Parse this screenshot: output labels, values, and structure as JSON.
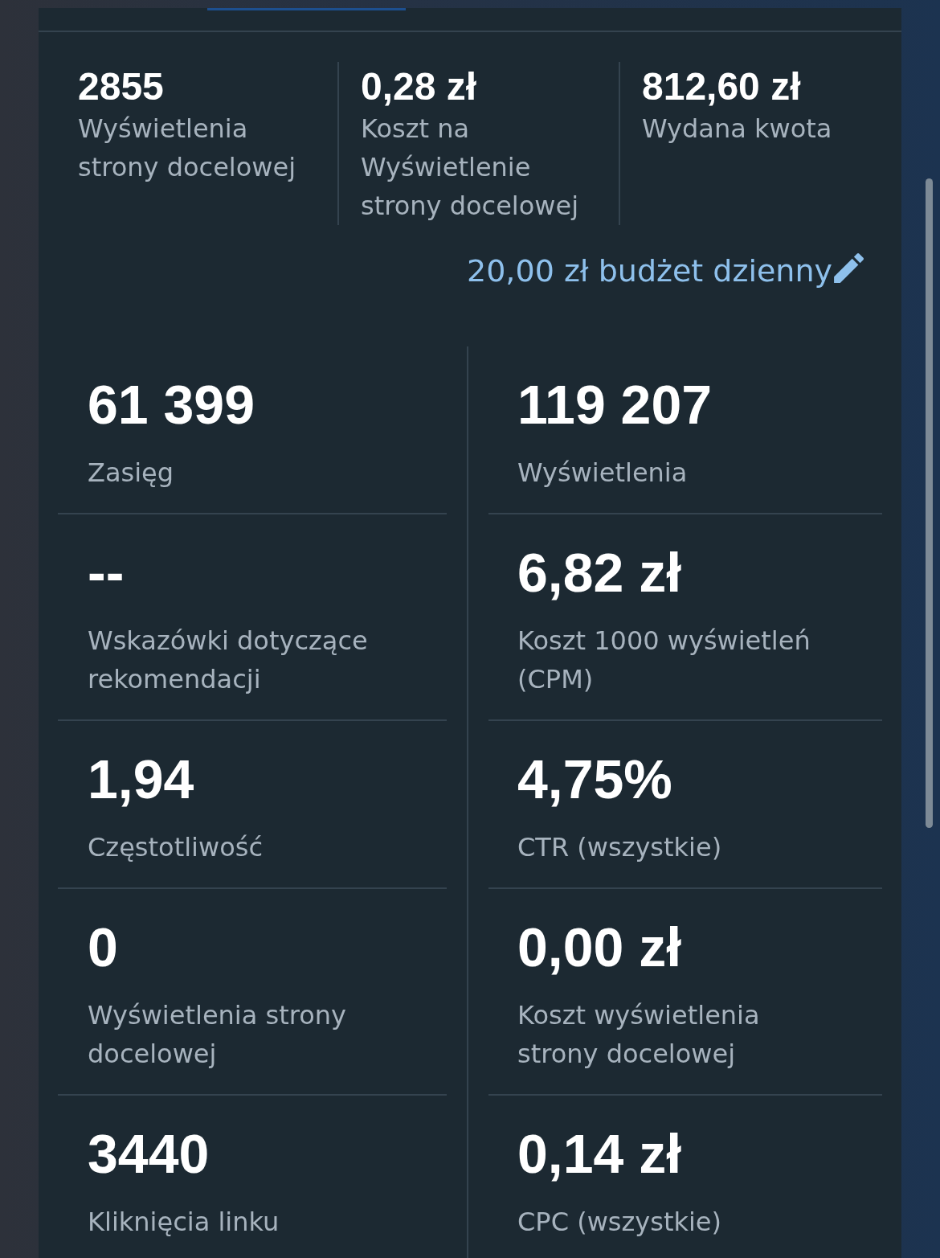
{
  "summary": [
    {
      "value": "2855",
      "label": "Wyświetlenia strony docelowej"
    },
    {
      "value": "0,28 zł",
      "label": "Koszt na Wyświetlenie strony docelowej"
    },
    {
      "value": "812,60 zł",
      "label": "Wydana kwota"
    }
  ],
  "budget_link": {
    "text": "20,00 zł budżet dzienny"
  },
  "metric_rows": [
    {
      "cells": [
        {
          "value": "61 399",
          "label": "Zasięg"
        },
        {
          "value": "119 207",
          "label": "Wyświetlenia"
        }
      ]
    },
    {
      "cells": [
        {
          "value": "--",
          "label": "Wskazówki dotyczące rekomendacji"
        },
        {
          "value": "6,82 zł",
          "label": "Koszt 1000 wyświetleń (CPM)"
        }
      ]
    },
    {
      "cells": [
        {
          "value": "1,94",
          "label": "Częstotliwość"
        },
        {
          "value": "4,75%",
          "label": "CTR (wszystkie)"
        }
      ]
    },
    {
      "cells": [
        {
          "value": "0",
          "label": "Wyświetlenia strony docelowej"
        },
        {
          "value": "0,00 zł",
          "label": "Koszt wyświetlenia strony docelowej"
        }
      ]
    },
    {
      "cells": [
        {
          "value": "3440",
          "label": "Kliknięcia linku"
        },
        {
          "value": "0,14 zł",
          "label": "CPC (wszystkie)"
        }
      ]
    }
  ]
}
